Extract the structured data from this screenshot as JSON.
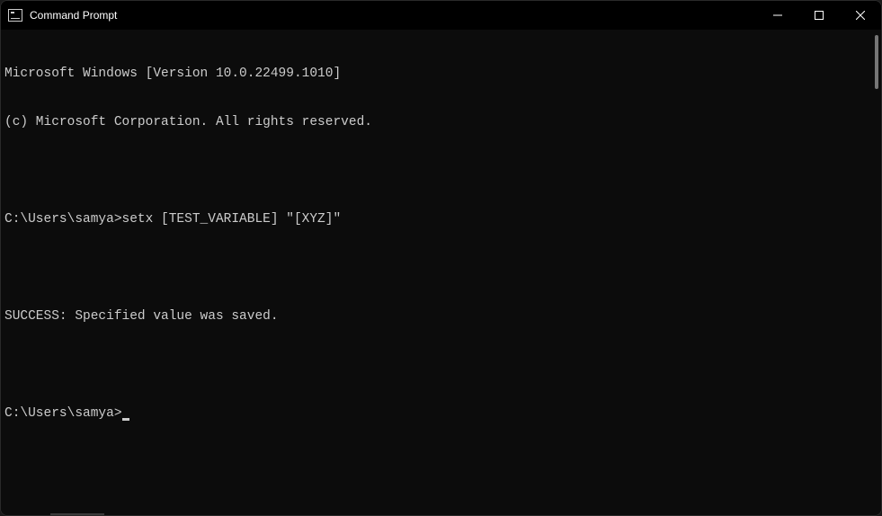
{
  "window": {
    "title": "Command Prompt"
  },
  "terminal": {
    "lines": [
      "Microsoft Windows [Version 10.0.22499.1010]",
      "(c) Microsoft Corporation. All rights reserved.",
      "",
      "C:\\Users\\samya>setx [TEST_VARIABLE] \"[XYZ]\"",
      "",
      "SUCCESS: Specified value was saved.",
      "",
      "C:\\Users\\samya>"
    ]
  }
}
